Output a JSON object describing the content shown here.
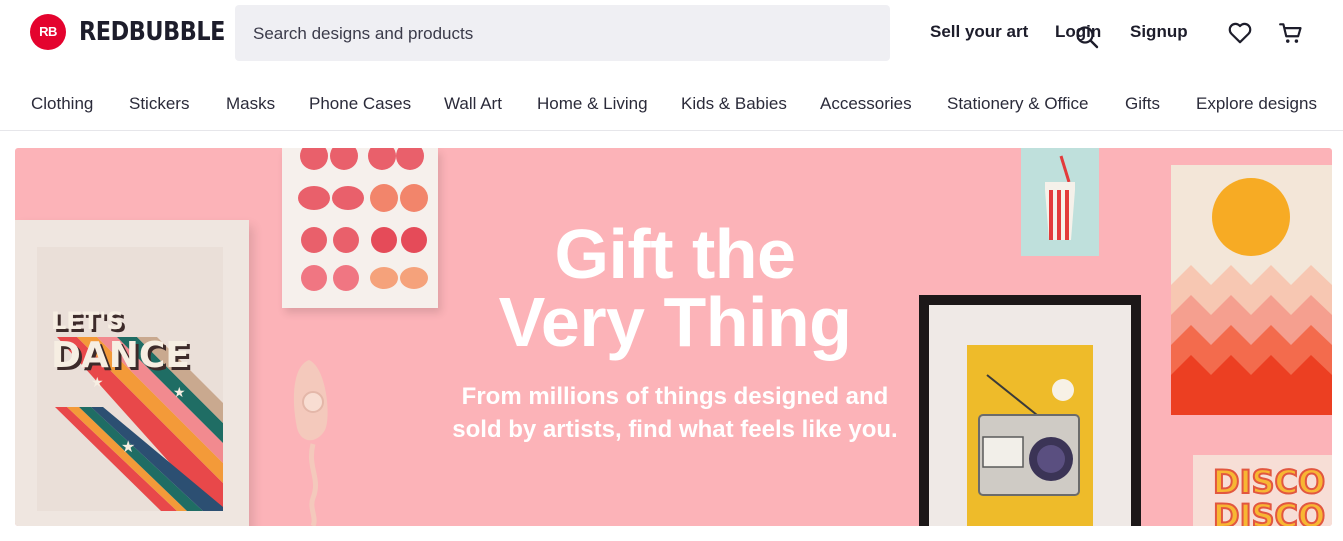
{
  "header": {
    "logo_mark": "RB",
    "logo_text": "REDBUBBLE",
    "search_placeholder": "Search designs and products",
    "links": {
      "sell": "Sell your art",
      "login": "Login",
      "signup": "Signup"
    },
    "icons": [
      "search-icon",
      "heart-icon",
      "cart-icon"
    ]
  },
  "categories": [
    "Clothing",
    "Stickers",
    "Masks",
    "Phone Cases",
    "Wall Art",
    "Home & Living",
    "Kids & Babies",
    "Accessories",
    "Stationery & Office",
    "Gifts",
    "Explore designs"
  ],
  "hero": {
    "title_line1": "Gift the",
    "title_line2": "Very Thing",
    "subtitle_line1": "From millions of things designed and",
    "subtitle_line2": "sold by artists, find what feels like you.",
    "poster_text_1": "LET'S",
    "poster_text_2": "DANCE",
    "disco_text": "DISCO",
    "background_color": "#fcb3b8"
  },
  "colors": {
    "brand": "#e4032e",
    "text_dark": "#1d1d2b",
    "search_bg": "#efeff3"
  }
}
